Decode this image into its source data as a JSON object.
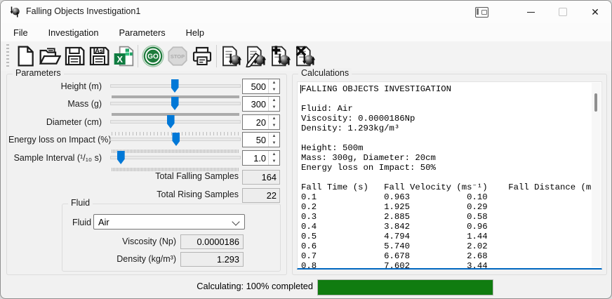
{
  "window": {
    "title": "Falling Objects Investigation1",
    "controls": {
      "minimize": "minimize",
      "maximize": "maximize",
      "close": "✕"
    }
  },
  "menu": {
    "items": [
      "File",
      "Investigation",
      "Parameters",
      "Help"
    ]
  },
  "toolbar": {
    "buttons": [
      {
        "name": "new-document",
        "icon": "new-document-icon",
        "sym": "i-new"
      },
      {
        "name": "open-file",
        "icon": "open-folder-icon",
        "sym": "i-open"
      },
      {
        "name": "save",
        "icon": "save-icon",
        "sym": "i-save"
      },
      {
        "name": "save-as",
        "icon": "save-as-icon",
        "sym": "i-saveas",
        "glyph": "As"
      },
      {
        "name": "export-excel",
        "icon": "excel-export-icon",
        "sym": "i-excel",
        "glyph": "X"
      },
      {
        "sep": true
      },
      {
        "name": "go",
        "icon": "go-icon",
        "sym": "i-go",
        "glyph": "GO"
      },
      {
        "name": "stop",
        "icon": "stop-icon",
        "sym": "i-stop",
        "glyph": "STOP",
        "disabled": true
      },
      {
        "name": "print",
        "icon": "print-icon",
        "sym": "i-print"
      },
      {
        "sep": true
      },
      {
        "name": "view-investigation",
        "icon": "investigation-view-icon",
        "sym": "i-inv"
      },
      {
        "name": "edit-investigation",
        "icon": "investigation-edit-icon",
        "sym": "i-inv-edit"
      },
      {
        "name": "add-investigation",
        "icon": "investigation-add-icon",
        "sym": "i-inv-add"
      },
      {
        "name": "delete-investigation",
        "icon": "investigation-delete-icon",
        "sym": "i-inv-del"
      }
    ]
  },
  "parameters": {
    "title": "Parameters",
    "sliders": [
      {
        "name": "height",
        "label": "Height (m)",
        "value": "500",
        "pos": 50,
        "ticks": "solid"
      },
      {
        "name": "mass",
        "label": "Mass (g)",
        "value": "300",
        "pos": 50,
        "ticks": "solid"
      },
      {
        "name": "diameter",
        "label": "Diameter (cm)",
        "value": "20",
        "pos": 47,
        "ticks": "sparse"
      },
      {
        "name": "energy-loss",
        "label": "Energy loss on Impact (%)",
        "value": "50",
        "pos": 51,
        "ticks": "dense"
      },
      {
        "name": "sample-interval",
        "label": "Sample Interval (¹/₁₀ s)",
        "value": "1.0",
        "pos": 11,
        "ticks": "dense"
      }
    ],
    "totals": [
      {
        "name": "total-falling-samples",
        "label": "Total Falling Samples",
        "value": "164"
      },
      {
        "name": "total-rising-samples",
        "label": "Total Rising Samples",
        "value": "22"
      }
    ],
    "fluid": {
      "title": "Fluid",
      "combo_label": "Fluid",
      "selected": "Air",
      "fields": [
        {
          "name": "viscosity",
          "label": "Viscosity (Np)",
          "value": "0.0000186"
        },
        {
          "name": "density",
          "label": "Density (kg/m³)",
          "value": "1.293"
        }
      ]
    }
  },
  "calculations": {
    "title": "Calculations",
    "header_lines": [
      "FALLING OBJECTS INVESTIGATION",
      "",
      "Fluid: Air",
      "Viscosity: 0.0000186Np",
      "Density: 1.293kg/m³",
      "",
      "Height: 500m",
      "Mass: 300g, Diameter: 20cm",
      "Energy loss on Impact: 50%",
      ""
    ],
    "table": {
      "columns": [
        "Fall Time (s)",
        "Fall Velocity (ms⁻¹)",
        "Fall Distance (m)"
      ],
      "rows": [
        [
          "0.1",
          "0.963",
          "0.10"
        ],
        [
          "0.2",
          "1.925",
          "0.29"
        ],
        [
          "0.3",
          "2.885",
          "0.58"
        ],
        [
          "0.4",
          "3.842",
          "0.96"
        ],
        [
          "0.5",
          "4.794",
          "1.44"
        ],
        [
          "0.6",
          "5.740",
          "2.02"
        ],
        [
          "0.7",
          "6.678",
          "2.68"
        ],
        [
          "0.8",
          "7.602",
          "3.44"
        ]
      ]
    }
  },
  "statusbar": {
    "label": "Calculating: 100% completed",
    "progress_percent": 100
  },
  "colors": {
    "accent_blue": "#0078d7",
    "focus_underline_blue": "#0067c0",
    "progress_green": "#107c10",
    "go_green": "#1e7b3c",
    "excel_green": "#107c41"
  }
}
